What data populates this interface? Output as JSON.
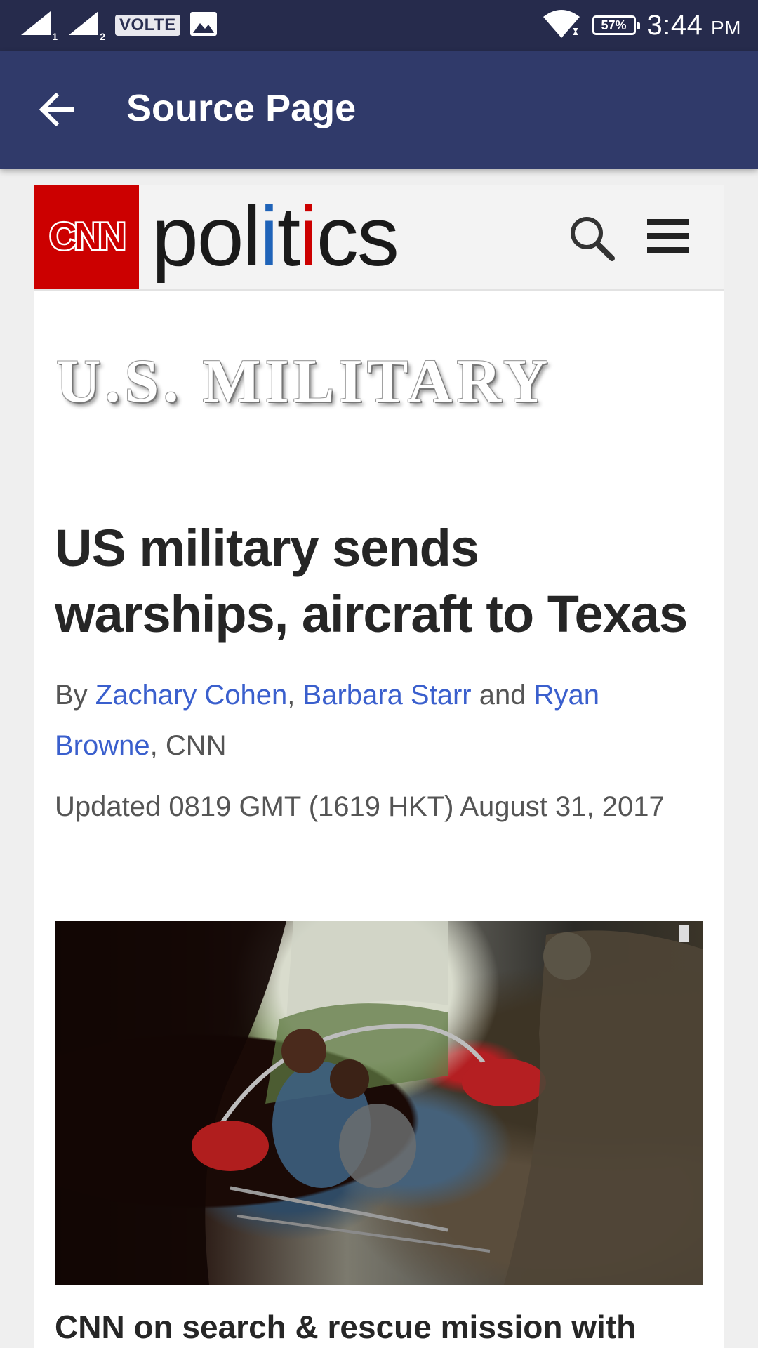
{
  "status_bar": {
    "sim1": "1",
    "sim2": "2",
    "volte": "VOLTE",
    "battery": "57%",
    "time": "3:44",
    "ampm": "PM"
  },
  "app_bar": {
    "title": "Source Page",
    "back_icon": "arrow-left-icon"
  },
  "site": {
    "logo_text": "CNN",
    "section_parts": [
      "pol",
      "i",
      "t",
      "i",
      "cs"
    ],
    "section_part_colors": [
      "#1a1a1a",
      "#1f63b8",
      "#1a1a1a",
      "#cc0000",
      "#1a1a1a"
    ],
    "search_icon": "search-icon",
    "menu_icon": "hamburger-menu-icon",
    "brand_red": "#cc0000"
  },
  "article": {
    "category": "U.S. MILITARY",
    "headline": "US military sends warships, aircraft to Texas",
    "byline_prefix": "By ",
    "authors": [
      "Zachary Cohen",
      "Barbara Starr",
      "Ryan Browne"
    ],
    "byline_sep1": ", ",
    "byline_sep2": " and ",
    "byline_suffix": ", CNN",
    "updated": "Updated 0819 GMT (1619 HKT) August 31, 2017",
    "image_watermark": "CNN",
    "caption": "CNN on search & rescue mission with"
  }
}
